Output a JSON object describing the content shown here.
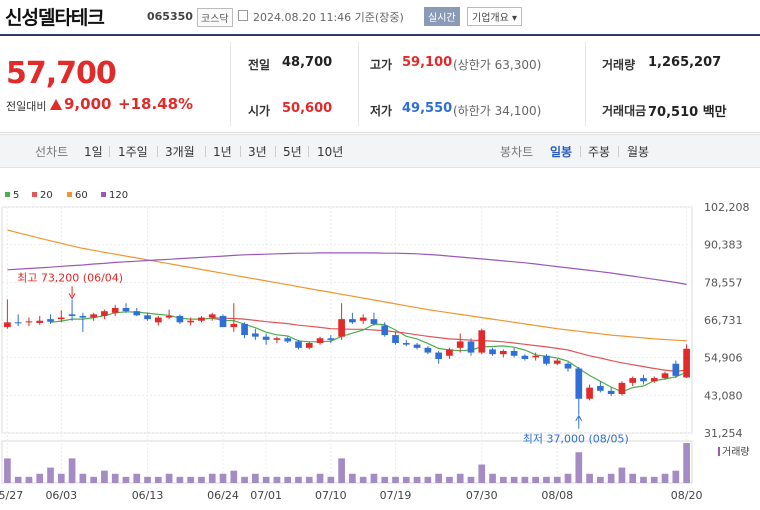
{
  "header": {
    "title": "신성델타테크",
    "code": "065350",
    "market": "코스닥",
    "datetime": "2024.08.20 11:46 기준(장중)",
    "realtime": "실시간",
    "company_info": "기업개요 ▾"
  },
  "summary": {
    "price": "57,700",
    "change_label": "전일대비",
    "change": "9,000",
    "change_pct": "+18.48%",
    "prev_label": "전일",
    "prev": "48,700",
    "open_label": "시가",
    "open": "50,600",
    "high_label": "고가",
    "high": "59,100",
    "upper_limit": "(상한가 63,300)",
    "low_label": "저가",
    "low": "49,550",
    "lower_limit": "(하한가 34,100)",
    "volume_label": "거래량",
    "volume": "1,265,207",
    "amount_label": "거래대금",
    "amount": "70,510 백만"
  },
  "tabs": {
    "line_chart": "선차트",
    "periods": [
      "1일",
      "1주일",
      "3개월",
      "1년",
      "3년",
      "5년",
      "10년"
    ],
    "candle_chart": "봉차트",
    "candles": [
      "일봉",
      "주봉",
      "월봉"
    ],
    "selected_candle": "일봉"
  },
  "colors": {
    "up": "#e12a2a",
    "down": "#2f6fd6",
    "ma5": "#4caf50",
    "ma20": "#e25555",
    "ma60": "#f0962f",
    "ma120": "#9b59b6"
  },
  "chart_data": {
    "type": "candlestick",
    "title": "",
    "ylim": [
      31254,
      102208
    ],
    "y_ticks": [
      "102,208",
      "90,383",
      "78,557",
      "66,731",
      "54,906",
      "43,080",
      "31,254"
    ],
    "x_ticks": [
      "05/27",
      "06/03",
      "06/13",
      "06/24",
      "07/01",
      "07/10",
      "07/19",
      "07/30",
      "08/08",
      "08/20"
    ],
    "legend": [
      "5",
      "20",
      "60",
      "120"
    ],
    "volume_label": "거래량",
    "annotations": {
      "high": "최고 73,200 (06/04)",
      "low": "최저 37,000 (08/05)"
    },
    "candles": [
      {
        "o": 64500,
        "h": 73200,
        "l": 64000,
        "c": 66000
      },
      {
        "o": 66000,
        "h": 68500,
        "l": 64800,
        "c": 65800
      },
      {
        "o": 66000,
        "h": 67500,
        "l": 64800,
        "c": 66300
      },
      {
        "o": 65800,
        "h": 68000,
        "l": 65200,
        "c": 66500
      },
      {
        "o": 67000,
        "h": 68500,
        "l": 65500,
        "c": 66200
      },
      {
        "o": 67000,
        "h": 69800,
        "l": 66000,
        "c": 67500
      },
      {
        "o": 68500,
        "h": 73200,
        "l": 66500,
        "c": 68000
      },
      {
        "o": 68000,
        "h": 69000,
        "l": 63000,
        "c": 67500
      },
      {
        "o": 67500,
        "h": 69000,
        "l": 66500,
        "c": 68500
      },
      {
        "o": 68000,
        "h": 70000,
        "l": 67000,
        "c": 69500
      },
      {
        "o": 69000,
        "h": 71500,
        "l": 68000,
        "c": 70500
      },
      {
        "o": 70500,
        "h": 72000,
        "l": 69000,
        "c": 69500
      },
      {
        "o": 69500,
        "h": 70500,
        "l": 68000,
        "c": 68200
      },
      {
        "o": 68200,
        "h": 69000,
        "l": 66500,
        "c": 67000
      },
      {
        "o": 66000,
        "h": 68000,
        "l": 65000,
        "c": 67500
      },
      {
        "o": 67500,
        "h": 70000,
        "l": 67000,
        "c": 68000
      },
      {
        "o": 68000,
        "h": 68500,
        "l": 65500,
        "c": 66000
      },
      {
        "o": 66000,
        "h": 67500,
        "l": 65000,
        "c": 66500
      },
      {
        "o": 66500,
        "h": 68000,
        "l": 66000,
        "c": 67500
      },
      {
        "o": 67500,
        "h": 69000,
        "l": 66500,
        "c": 68500
      },
      {
        "o": 68000,
        "h": 68500,
        "l": 65000,
        "c": 64500
      },
      {
        "o": 64500,
        "h": 72000,
        "l": 63000,
        "c": 65500
      },
      {
        "o": 65500,
        "h": 66000,
        "l": 61000,
        "c": 62000
      },
      {
        "o": 62500,
        "h": 64000,
        "l": 60500,
        "c": 61500
      },
      {
        "o": 61500,
        "h": 62500,
        "l": 59000,
        "c": 60500
      },
      {
        "o": 60500,
        "h": 61500,
        "l": 59500,
        "c": 61000
      },
      {
        "o": 61000,
        "h": 61500,
        "l": 59500,
        "c": 60000
      },
      {
        "o": 60000,
        "h": 60500,
        "l": 57500,
        "c": 58000
      },
      {
        "o": 58000,
        "h": 60000,
        "l": 57500,
        "c": 59500
      },
      {
        "o": 59500,
        "h": 61500,
        "l": 59000,
        "c": 61000
      },
      {
        "o": 61000,
        "h": 62000,
        "l": 59500,
        "c": 60500
      },
      {
        "o": 61500,
        "h": 72000,
        "l": 60500,
        "c": 67000
      },
      {
        "o": 67000,
        "h": 69000,
        "l": 65500,
        "c": 66000
      },
      {
        "o": 66500,
        "h": 68500,
        "l": 65500,
        "c": 67500
      },
      {
        "o": 67000,
        "h": 69000,
        "l": 65000,
        "c": 65500
      },
      {
        "o": 65000,
        "h": 66000,
        "l": 61500,
        "c": 62000
      },
      {
        "o": 62000,
        "h": 63000,
        "l": 59000,
        "c": 59500
      },
      {
        "o": 59500,
        "h": 60500,
        "l": 58500,
        "c": 59000
      },
      {
        "o": 59000,
        "h": 59500,
        "l": 57500,
        "c": 58000
      },
      {
        "o": 58000,
        "h": 58500,
        "l": 56000,
        "c": 56500
      },
      {
        "o": 56500,
        "h": 57000,
        "l": 53000,
        "c": 54500
      },
      {
        "o": 55500,
        "h": 58000,
        "l": 54500,
        "c": 57500
      },
      {
        "o": 58000,
        "h": 62500,
        "l": 56500,
        "c": 60000
      },
      {
        "o": 60000,
        "h": 61000,
        "l": 55500,
        "c": 56500
      },
      {
        "o": 56500,
        "h": 64000,
        "l": 56000,
        "c": 63500
      },
      {
        "o": 57500,
        "h": 58000,
        "l": 55500,
        "c": 56000
      },
      {
        "o": 56000,
        "h": 57500,
        "l": 55000,
        "c": 57000
      },
      {
        "o": 57000,
        "h": 58000,
        "l": 55000,
        "c": 55500
      },
      {
        "o": 55500,
        "h": 56000,
        "l": 54000,
        "c": 54500
      },
      {
        "o": 55000,
        "h": 56500,
        "l": 54000,
        "c": 55500
      },
      {
        "o": 55500,
        "h": 56000,
        "l": 52500,
        "c": 53000
      },
      {
        "o": 53000,
        "h": 54500,
        "l": 52500,
        "c": 54000
      },
      {
        "o": 53000,
        "h": 53500,
        "l": 50500,
        "c": 51500
      },
      {
        "o": 51500,
        "h": 52000,
        "l": 37000,
        "c": 42000
      },
      {
        "o": 42000,
        "h": 46500,
        "l": 41500,
        "c": 45500
      },
      {
        "o": 46000,
        "h": 47500,
        "l": 44000,
        "c": 44500
      },
      {
        "o": 44500,
        "h": 45500,
        "l": 42800,
        "c": 43500
      },
      {
        "o": 43500,
        "h": 47500,
        "l": 43000,
        "c": 47000
      },
      {
        "o": 47000,
        "h": 49000,
        "l": 46000,
        "c": 48500
      },
      {
        "o": 48500,
        "h": 49500,
        "l": 46500,
        "c": 47500
      },
      {
        "o": 47500,
        "h": 49000,
        "l": 47000,
        "c": 48500
      },
      {
        "o": 48500,
        "h": 50500,
        "l": 48000,
        "c": 50000
      },
      {
        "o": 53000,
        "h": 54000,
        "l": 48500,
        "c": 49200
      },
      {
        "o": 48700,
        "h": 59100,
        "l": 48500,
        "c": 57700
      }
    ],
    "series": [
      {
        "name": "5",
        "values": [
          null,
          null,
          null,
          null,
          66000,
          66400,
          67000,
          67000,
          67500,
          68100,
          69000,
          69300,
          69200,
          68900,
          68500,
          68200,
          67300,
          67000,
          67000,
          67300,
          66600,
          66500,
          65400,
          64300,
          62900,
          62100,
          61700,
          60200,
          59900,
          59900,
          60100,
          61600,
          62600,
          63600,
          65400,
          65300,
          63600,
          61600,
          60800,
          59400,
          57800,
          57300,
          57100,
          57300,
          58300,
          58400,
          58600,
          58200,
          57300,
          55800,
          55300,
          54800,
          53800,
          51500,
          49300,
          47500,
          45700,
          44200,
          45500,
          46000,
          47700,
          48200,
          48900,
          50300
        ]
      },
      {
        "name": "20",
        "values": [
          null,
          null,
          null,
          null,
          null,
          null,
          null,
          null,
          null,
          null,
          null,
          null,
          null,
          null,
          null,
          null,
          null,
          null,
          null,
          67400,
          67300,
          67200,
          67000,
          66600,
          66200,
          65900,
          65600,
          65100,
          64800,
          64400,
          64000,
          63900,
          63800,
          63800,
          63600,
          63400,
          63000,
          62600,
          62100,
          61600,
          61200,
          60800,
          60600,
          60400,
          60300,
          60100,
          59900,
          59500,
          59100,
          58700,
          58300,
          57800,
          57300,
          56400,
          55500,
          54800,
          54000,
          53300,
          52700,
          52100,
          51500,
          51000,
          50600,
          51000
        ]
      },
      {
        "name": "60",
        "values": [
          95000,
          94100,
          93300,
          92400,
          91600,
          90800,
          90000,
          89200,
          88600,
          88000,
          87400,
          86800,
          86200,
          85600,
          85000,
          84400,
          83800,
          83200,
          82600,
          82000,
          81400,
          80800,
          80200,
          79600,
          79000,
          78400,
          77800,
          77200,
          76600,
          76000,
          75400,
          74800,
          74200,
          73600,
          73000,
          72400,
          71800,
          71200,
          70600,
          70000,
          69500,
          69000,
          68500,
          68000,
          67500,
          67000,
          66500,
          66000,
          65500,
          65000,
          64500,
          64000,
          63600,
          63200,
          62800,
          62400,
          62000,
          61700,
          61400,
          61100,
          60800,
          60600,
          60400,
          60200
        ]
      },
      {
        "name": "120",
        "values": [
          82500,
          82700,
          82900,
          83100,
          83300,
          83600,
          83800,
          84000,
          84300,
          84500,
          84800,
          85000,
          85200,
          85400,
          85600,
          85800,
          86000,
          86200,
          86400,
          86600,
          86800,
          87000,
          87200,
          87300,
          87400,
          87500,
          87600,
          87700,
          87700,
          87800,
          87800,
          87800,
          87800,
          87800,
          87800,
          87700,
          87700,
          87600,
          87500,
          87300,
          87100,
          86800,
          86500,
          86200,
          85900,
          85600,
          85300,
          85000,
          84700,
          84300,
          83900,
          83500,
          83100,
          82700,
          82300,
          81900,
          81500,
          81000,
          80500,
          80000,
          79500,
          79000,
          78500,
          77900
        ]
      }
    ],
    "volume": [
      8,
      2,
      2,
      3,
      5,
      3,
      8,
      3,
      2,
      4,
      3,
      2,
      3,
      2,
      2,
      3,
      2,
      2,
      2,
      3,
      3,
      4,
      2,
      3,
      2,
      2,
      2,
      2,
      2,
      3,
      2,
      8,
      3,
      2,
      3,
      2,
      2,
      2,
      2,
      2,
      3,
      2,
      3,
      2,
      6,
      3,
      2,
      2,
      2,
      2,
      2,
      2,
      3,
      10,
      3,
      2,
      3,
      5,
      3,
      2,
      2,
      3,
      4,
      13
    ]
  }
}
